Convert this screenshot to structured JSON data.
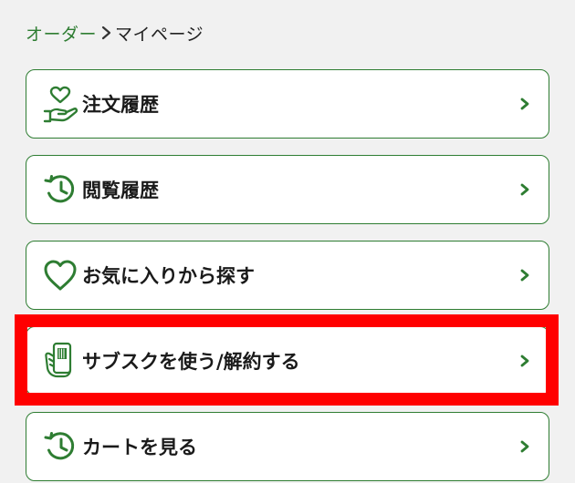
{
  "breadcrumb": {
    "parent_label": "オーダー",
    "current_label": "マイページ"
  },
  "menu": {
    "items": [
      {
        "label": "注文履歴",
        "icon": "hand-heart-icon"
      },
      {
        "label": "閲覧履歴",
        "icon": "history-icon"
      },
      {
        "label": "お気に入りから探す",
        "icon": "heart-icon"
      },
      {
        "label": "サブスクを使う/解約する",
        "icon": "phone-in-hand-icon"
      },
      {
        "label": "カートを見る",
        "icon": "history-icon"
      }
    ]
  },
  "colors": {
    "accent": "#2e7d32",
    "highlight": "#ff0000",
    "background": "#f1f1f1"
  }
}
